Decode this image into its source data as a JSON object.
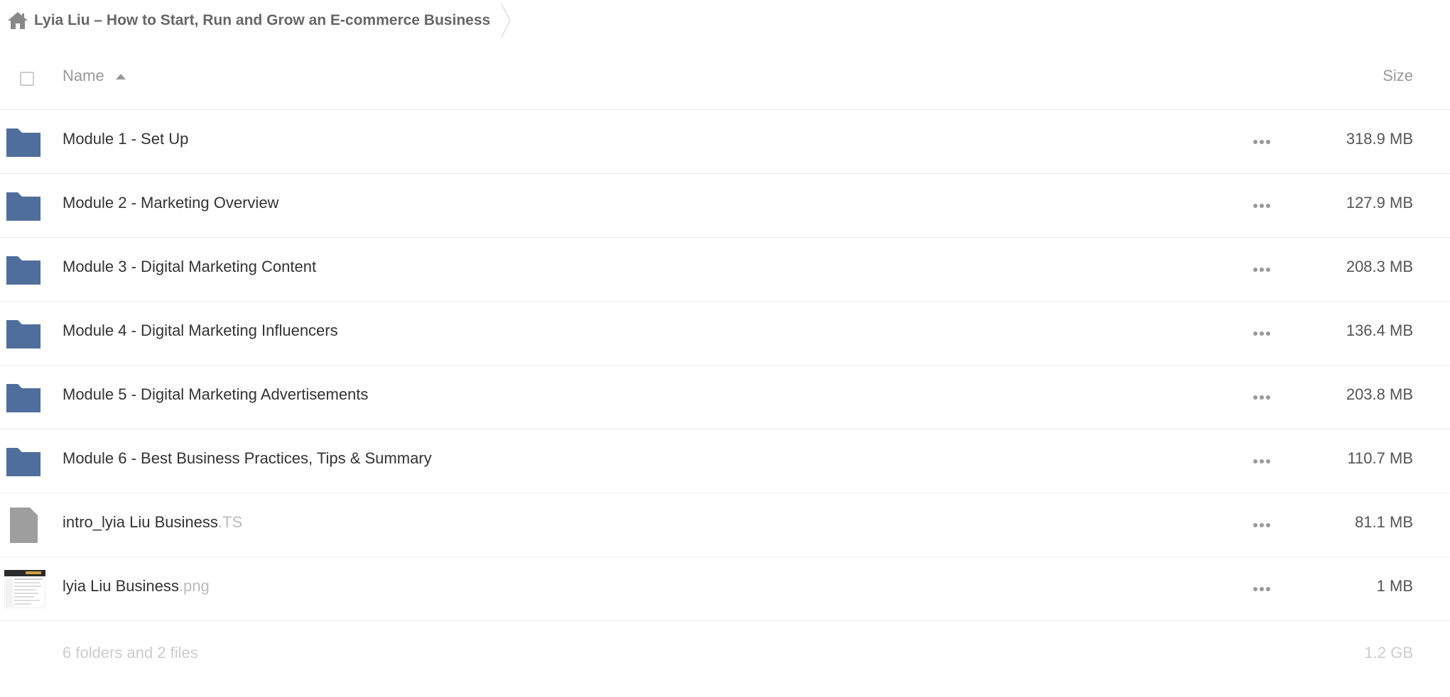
{
  "breadcrumb": {
    "home_icon": "home-icon",
    "title": "Lyia Liu – How to Start, Run and Grow an E-commerce Business"
  },
  "header": {
    "name_label": "Name",
    "size_label": "Size",
    "sort": "name-ascending"
  },
  "colors": {
    "folder": "#4f6e9c",
    "file": "#9e9e9e",
    "text_muted": "#999999"
  },
  "rows": [
    {
      "type": "folder",
      "icon": "folder-icon",
      "name": "Module 1 - Set Up",
      "ext": "",
      "size": "318.9 MB"
    },
    {
      "type": "folder",
      "icon": "folder-icon",
      "name": "Module 2 - Marketing Overview",
      "ext": "",
      "size": "127.9 MB"
    },
    {
      "type": "folder",
      "icon": "folder-icon",
      "name": "Module 3 - Digital Marketing Content",
      "ext": "",
      "size": "208.3 MB"
    },
    {
      "type": "folder",
      "icon": "folder-icon",
      "name": "Module 4 - Digital Marketing Influencers",
      "ext": "",
      "size": "136.4 MB"
    },
    {
      "type": "folder",
      "icon": "folder-icon",
      "name": "Module 5 - Digital Marketing Advertisements",
      "ext": "",
      "size": "203.8 MB"
    },
    {
      "type": "folder",
      "icon": "folder-icon",
      "name": "Module 6 - Best Business Practices, Tips & Summary",
      "ext": "",
      "size": "110.7 MB"
    },
    {
      "type": "file",
      "icon": "file-icon",
      "name": "intro_lyia Liu Business",
      "ext": ".TS",
      "size": "81.1 MB"
    },
    {
      "type": "image",
      "icon": "image-thumbnail",
      "name": "lyia Liu Business",
      "ext": ".png",
      "size": "1 MB"
    }
  ],
  "summary": {
    "text": "6 folders and 2 files",
    "total_size": "1.2 GB"
  }
}
